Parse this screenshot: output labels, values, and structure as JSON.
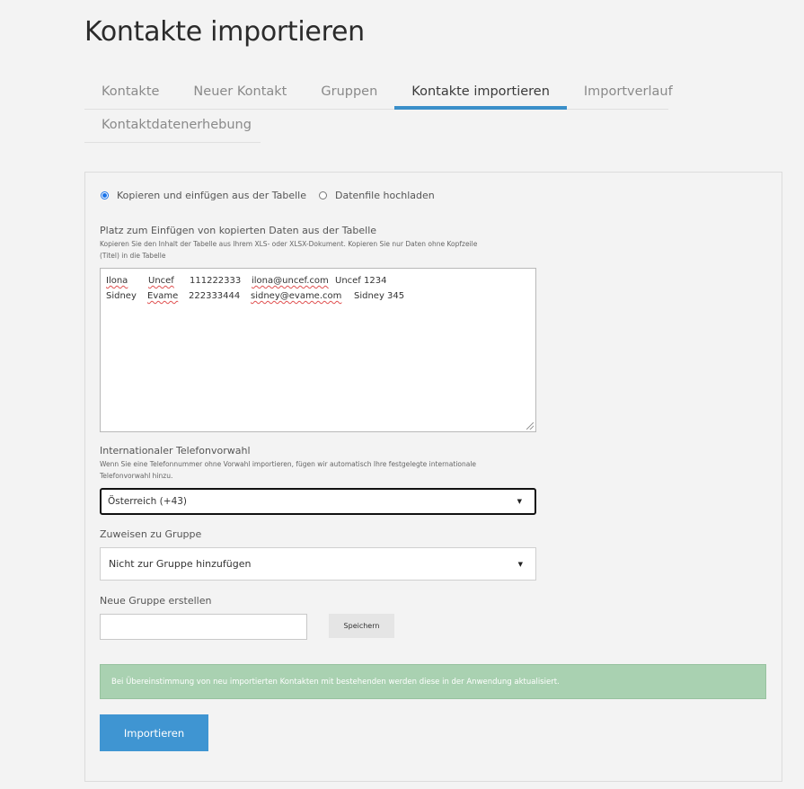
{
  "page": {
    "title": "Kontakte importieren"
  },
  "tabs": {
    "row1": [
      "Kontakte",
      "Neuer Kontakt",
      "Gruppen",
      "Kontakte importieren",
      "Importverlauf"
    ],
    "row2": [
      "Kontaktdatenerhebung"
    ],
    "active": "Kontakte importieren"
  },
  "import_mode": {
    "options": [
      "Kopieren und einfügen aus der Tabelle",
      "Datenfile hochladen"
    ],
    "selected": "Kopieren und einfügen aus der Tabelle"
  },
  "paste_area": {
    "label": "Platz zum Einfügen von kopierten Daten aus der Tabelle",
    "help_line1": "Kopieren Sie den Inhalt der Tabelle aus Ihrem XLS- oder XLSX-Dokument. Kopieren Sie nur Daten ohne Kopfzeile",
    "help_line2": "(Titel) in die Tabelle",
    "rows": [
      [
        "Ilona",
        "Uncef",
        "111222333",
        "ilona@uncef.com",
        "Uncef 1234"
      ],
      [
        "Sidney",
        "Evame",
        "222333444",
        "sidney@evame.com",
        "Sidney 345"
      ]
    ]
  },
  "phone_prefix": {
    "label": "Internationaler Telefonvorwahl",
    "help_line1": "Wenn Sie eine Telefonnummer ohne Vorwahl importieren, fügen wir automatisch Ihre festgelegte internationale",
    "help_line2": "Telefonvorwahl hinzu.",
    "value": "Österreich (+43)"
  },
  "assign_group": {
    "label": "Zuweisen zu Gruppe",
    "value": "Nicht zur Gruppe hinzufügen"
  },
  "new_group": {
    "label": "Neue Gruppe erstellen",
    "value": "",
    "save_label": "Speichern"
  },
  "notice": "Bei Übereinstimmung von neu importierten Kontakten mit bestehenden werden diese in der Anwendung aktualisiert.",
  "import_button": "Importieren",
  "colors": {
    "accent": "#3f95d2",
    "tab_underline": "#3a8fc9",
    "notice_bg": "#a9d1b1",
    "radio": "#1a73e8"
  }
}
